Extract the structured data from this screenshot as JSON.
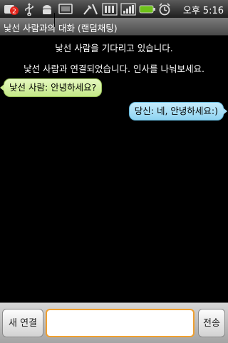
{
  "status_bar": {
    "notification_count": "2",
    "ampm": "오후",
    "time": "5:16",
    "icons": [
      "notification-icon",
      "usb-icon",
      "android-icon",
      "screen-icon",
      "tools-icon",
      "signal-icon",
      "signal-bars-icon",
      "battery-icon",
      "alarm-icon"
    ]
  },
  "title_bar": {
    "title": "낯선 사람과의 대화 (랜덤채팅)"
  },
  "chat": {
    "system_messages": [
      "낯선 사람을 기다리고 있습니다.",
      "낯선 사람과 연결되었습니다. 인사를 나눠보세요."
    ],
    "stranger_message": "낯선 사람: 안녕하세요?",
    "my_message": "당신: 네, 안녕하세요:)"
  },
  "bottom_bar": {
    "new_connection_label": "새 연결",
    "send_label": "전송",
    "input_value": "",
    "input_placeholder": ""
  },
  "colors": {
    "stranger_bubble": "#d4f0a4",
    "my_bubble": "#a3dbf4",
    "input_focus": "#f0a030"
  }
}
